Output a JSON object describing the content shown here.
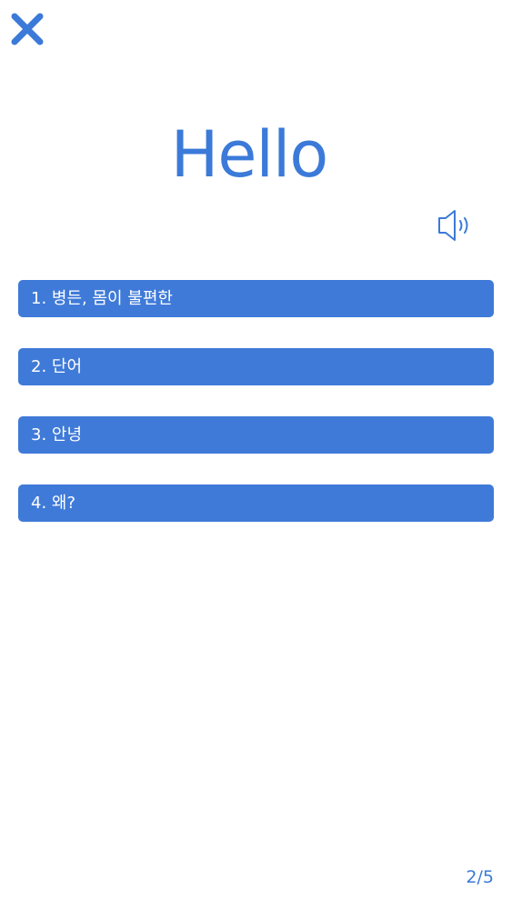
{
  "quiz": {
    "word": "Hello",
    "options": [
      {
        "label": "1. 병든, 몸이 불편한"
      },
      {
        "label": "2. 단어"
      },
      {
        "label": "3. 안녕"
      },
      {
        "label": "4. 왜?"
      }
    ],
    "progress": "2/5"
  },
  "icons": {
    "close": "close-icon",
    "speaker": "speaker-icon"
  },
  "colors": {
    "accent": "#3b7ad8",
    "option_bg": "#3f7ad8",
    "option_text": "#ffffff",
    "background": "#ffffff"
  }
}
